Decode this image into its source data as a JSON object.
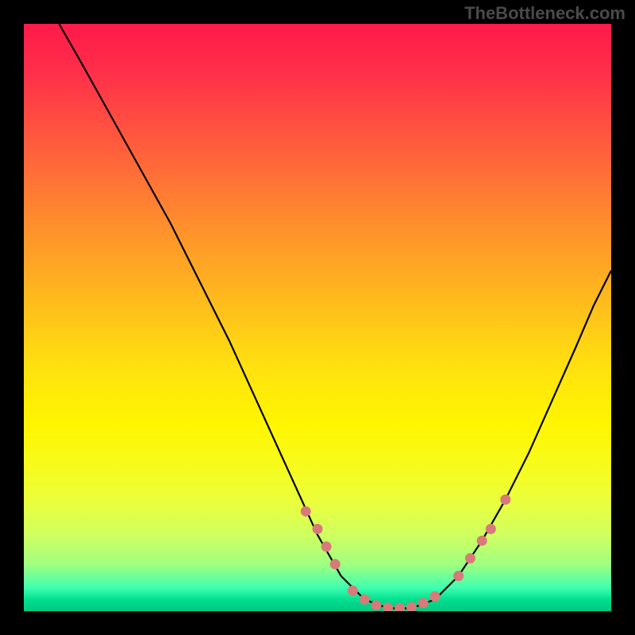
{
  "watermark": "TheBottleneck.com",
  "chart_data": {
    "type": "line",
    "title": "",
    "xlabel": "",
    "ylabel": "",
    "xlim": [
      0,
      100
    ],
    "ylim": [
      0,
      100
    ],
    "curve_points": [
      {
        "x": 6,
        "y": 100
      },
      {
        "x": 10,
        "y": 93
      },
      {
        "x": 15,
        "y": 84
      },
      {
        "x": 20,
        "y": 75
      },
      {
        "x": 25,
        "y": 66
      },
      {
        "x": 30,
        "y": 56
      },
      {
        "x": 35,
        "y": 46
      },
      {
        "x": 40,
        "y": 35
      },
      {
        "x": 45,
        "y": 24
      },
      {
        "x": 50,
        "y": 13
      },
      {
        "x": 54,
        "y": 6
      },
      {
        "x": 58,
        "y": 2
      },
      {
        "x": 62,
        "y": 0.5
      },
      {
        "x": 66,
        "y": 0.5
      },
      {
        "x": 70,
        "y": 2
      },
      {
        "x": 74,
        "y": 6
      },
      {
        "x": 78,
        "y": 12
      },
      {
        "x": 82,
        "y": 19
      },
      {
        "x": 86,
        "y": 27
      },
      {
        "x": 90,
        "y": 36
      },
      {
        "x": 94,
        "y": 45
      },
      {
        "x": 97,
        "y": 52
      },
      {
        "x": 100,
        "y": 58
      }
    ],
    "markers": [
      {
        "x": 48,
        "y": 17
      },
      {
        "x": 50,
        "y": 14
      },
      {
        "x": 51.5,
        "y": 11
      },
      {
        "x": 53,
        "y": 8
      },
      {
        "x": 56,
        "y": 3.5
      },
      {
        "x": 58,
        "y": 2
      },
      {
        "x": 60,
        "y": 1
      },
      {
        "x": 62,
        "y": 0.6
      },
      {
        "x": 64,
        "y": 0.5
      },
      {
        "x": 66,
        "y": 0.7
      },
      {
        "x": 68,
        "y": 1.4
      },
      {
        "x": 70,
        "y": 2.5
      },
      {
        "x": 74,
        "y": 6
      },
      {
        "x": 76,
        "y": 9
      },
      {
        "x": 78,
        "y": 12
      },
      {
        "x": 79.5,
        "y": 14
      },
      {
        "x": 82,
        "y": 19
      }
    ]
  }
}
